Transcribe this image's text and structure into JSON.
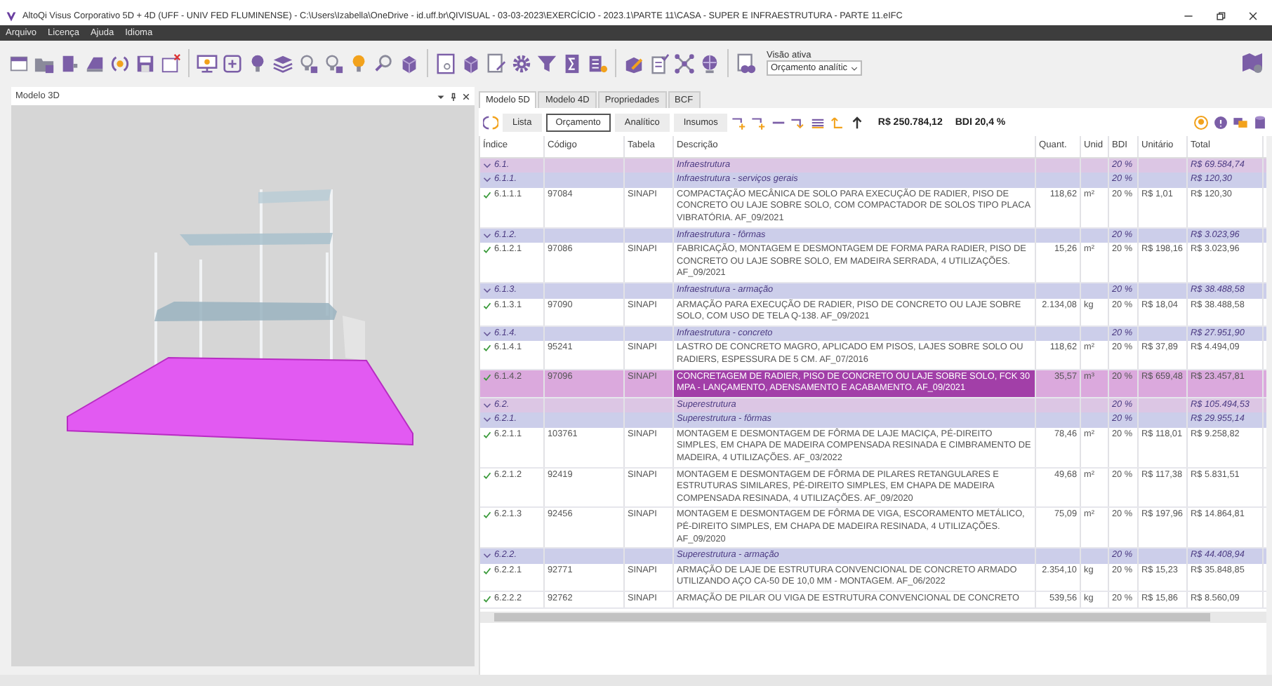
{
  "window": {
    "title": "AltoQi Visus Corporativo 5D + 4D (UFF - UNIV FED FLUMINENSE) - C:\\Users\\Izabella\\OneDrive - id.uff.br\\QIVISUAL - 03-03-2023\\EXERCÍCIO - 2023.1\\PARTE 11\\CASA - SUPER E INFRAESTRUTURA - PARTE 11.eIFC"
  },
  "menu": [
    "Arquivo",
    "Licença",
    "Ajuda",
    "Idioma"
  ],
  "toolbar": {
    "active_view_label": "Visão ativa",
    "active_view": "Orçamento analític"
  },
  "model_panel": {
    "title": "Modelo 3D"
  },
  "tabs": [
    {
      "label": "Modelo 5D",
      "selected": true
    },
    {
      "label": "Modelo 4D",
      "selected": false
    },
    {
      "label": "Propriedades",
      "selected": false
    },
    {
      "label": "BCF",
      "selected": false
    }
  ],
  "budget": {
    "views": [
      {
        "label": "Lista",
        "selected": false
      },
      {
        "label": "Orçamento",
        "selected": true
      },
      {
        "label": "Analítico",
        "selected": false
      },
      {
        "label": "Insumos",
        "selected": false
      }
    ],
    "total": "R$ 250.784,12",
    "bdi": "BDI 20,4 %"
  },
  "table": {
    "columns": [
      "Índice",
      "Código",
      "Tabela",
      "Descrição",
      "Quant.",
      "Unid",
      "BDI",
      "Unitário",
      "Total"
    ],
    "rows": [
      {
        "kind": "group",
        "index": "6.1.",
        "description": "Infraestrutura",
        "bdi": "20 %",
        "total": "R$ 69.584,74",
        "expanded": true,
        "selected": false,
        "children": [
          {
            "kind": "group",
            "index": "6.1.1.",
            "description": "Infraestrutura - serviços gerais",
            "bdi": "20 %",
            "total": "R$ 120,30",
            "expanded": true,
            "selected": false,
            "children": [
              {
                "kind": "item",
                "index": "6.1.1.1",
                "code": "97084",
                "table": "SINAPI",
                "description": "COMPACTAÇÃO MECÂNICA DE SOLO PARA EXECUÇÃO DE RADIER, PISO DE CONCRETO OU LAJE SOBRE SOLO, COM COMPACTADOR DE SOLOS TIPO PLACA VIBRATÓRIA. AF_09/2021",
                "quantity": "118,62",
                "unit": "m²",
                "bdi": "20 %",
                "unit_price": "R$ 1,01",
                "total": "R$ 120,30",
                "checked": true,
                "selected": false
              }
            ]
          },
          {
            "kind": "group",
            "index": "6.1.2.",
            "description": "Infraestrutura - fôrmas",
            "bdi": "20 %",
            "total": "R$ 3.023,96",
            "expanded": true,
            "selected": false,
            "children": [
              {
                "kind": "item",
                "index": "6.1.2.1",
                "code": "97086",
                "table": "SINAPI",
                "description": "FABRICAÇÃO, MONTAGEM E DESMONTAGEM DE FORMA PARA RADIER, PISO DE CONCRETO OU LAJE SOBRE SOLO, EM MADEIRA SERRADA, 4 UTILIZAÇÕES. AF_09/2021",
                "quantity": "15,26",
                "unit": "m²",
                "bdi": "20 %",
                "unit_price": "R$ 198,16",
                "total": "R$ 3.023,96",
                "checked": true,
                "selected": false
              }
            ]
          },
          {
            "kind": "group",
            "index": "6.1.3.",
            "description": "Infraestrutura - armação",
            "bdi": "20 %",
            "total": "R$ 38.488,58",
            "expanded": true,
            "selected": false,
            "children": [
              {
                "kind": "item",
                "index": "6.1.3.1",
                "code": "97090",
                "table": "SINAPI",
                "description": "ARMAÇÃO PARA EXECUÇÃO DE RADIER, PISO DE CONCRETO OU LAJE SOBRE SOLO, COM USO DE TELA Q-138. AF_09/2021",
                "quantity": "2.134,08",
                "unit": "kg",
                "bdi": "20 %",
                "unit_price": "R$ 18,04",
                "total": "R$ 38.488,58",
                "checked": true,
                "selected": false
              }
            ]
          },
          {
            "kind": "group",
            "index": "6.1.4.",
            "description": "Infraestrutura - concreto",
            "bdi": "20 %",
            "total": "R$ 27.951,90",
            "expanded": true,
            "selected": false,
            "children": [
              {
                "kind": "item",
                "index": "6.1.4.1",
                "code": "95241",
                "table": "SINAPI",
                "description": "LASTRO DE CONCRETO MAGRO, APLICADO EM PISOS, LAJES SOBRE SOLO OU RADIERS, ESPESSURA DE 5 CM. AF_07/2016",
                "quantity": "118,62",
                "unit": "m²",
                "bdi": "20 %",
                "unit_price": "R$ 37,89",
                "total": "R$ 4.494,09",
                "checked": true,
                "selected": false
              },
              {
                "kind": "item",
                "index": "6.1.4.2",
                "code": "97096",
                "table": "SINAPI",
                "description": "CONCRETAGEM DE RADIER, PISO DE CONCRETO OU LAJE SOBRE SOLO, FCK 30 MPA - LANÇAMENTO, ADENSAMENTO E ACABAMENTO. AF_09/2021",
                "quantity": "35,57",
                "unit": "m³",
                "bdi": "20 %",
                "unit_price": "R$ 659,48",
                "total": "R$ 23.457,81",
                "checked": true,
                "selected": true
              }
            ]
          }
        ]
      },
      {
        "kind": "group",
        "index": "6.2.",
        "description": "Superestrutura",
        "bdi": "20 %",
        "total": "R$ 105.494,53",
        "expanded": true,
        "selected": false,
        "children": [
          {
            "kind": "group",
            "index": "6.2.1.",
            "description": "Superestrutura - fôrmas",
            "bdi": "20 %",
            "total": "R$ 29.955,14",
            "expanded": true,
            "selected": false,
            "children": [
              {
                "kind": "item",
                "index": "6.2.1.1",
                "code": "103761",
                "table": "SINAPI",
                "description": "MONTAGEM E DESMONTAGEM DE FÔRMA DE LAJE MACIÇA, PÉ-DIREITO SIMPLES, EM CHAPA DE MADEIRA COMPENSADA RESINADA E CIMBRAMENTO DE MADEIRA, 4 UTILIZAÇÕES. AF_03/2022",
                "quantity": "78,46",
                "unit": "m²",
                "bdi": "20 %",
                "unit_price": "R$ 118,01",
                "total": "R$ 9.258,82",
                "checked": true,
                "selected": false
              },
              {
                "kind": "item",
                "index": "6.2.1.2",
                "code": "92419",
                "table": "SINAPI",
                "description": "MONTAGEM E DESMONTAGEM DE FÔRMA DE PILARES RETANGULARES E ESTRUTURAS SIMILARES, PÉ-DIREITO SIMPLES, EM CHAPA DE MADEIRA COMPENSADA RESINADA, 4 UTILIZAÇÕES. AF_09/2020",
                "quantity": "49,68",
                "unit": "m²",
                "bdi": "20 %",
                "unit_price": "R$ 117,38",
                "total": "R$ 5.831,51",
                "checked": true,
                "selected": false
              },
              {
                "kind": "item",
                "index": "6.2.1.3",
                "code": "92456",
                "table": "SINAPI",
                "description": "MONTAGEM E DESMONTAGEM DE FÔRMA DE VIGA, ESCORAMENTO METÁLICO, PÉ-DIREITO SIMPLES, EM CHAPA DE MADEIRA RESINADA, 4 UTILIZAÇÕES. AF_09/2020",
                "quantity": "75,09",
                "unit": "m²",
                "bdi": "20 %",
                "unit_price": "R$ 197,96",
                "total": "R$ 14.864,81",
                "checked": true,
                "selected": false
              }
            ]
          },
          {
            "kind": "group",
            "index": "6.2.2.",
            "description": "Superestrutura - armação",
            "bdi": "20 %",
            "total": "R$ 44.408,94",
            "expanded": true,
            "selected": false,
            "children": [
              {
                "kind": "item",
                "index": "6.2.2.1",
                "code": "92771",
                "table": "SINAPI",
                "description": "ARMAÇÃO DE LAJE DE ESTRUTURA CONVENCIONAL DE CONCRETO ARMADO UTILIZANDO AÇO CA-50 DE 10,0 MM - MONTAGEM. AF_06/2022",
                "quantity": "2.354,10",
                "unit": "kg",
                "bdi": "20 %",
                "unit_price": "R$ 15,23",
                "total": "R$ 35.848,85",
                "checked": true,
                "selected": false
              },
              {
                "kind": "item",
                "index": "6.2.2.2",
                "code": "92762",
                "table": "SINAPI",
                "description": "ARMAÇÃO DE PILAR OU VIGA DE ESTRUTURA CONVENCIONAL DE CONCRETO",
                "quantity": "539,56",
                "unit": "kg",
                "bdi": "20 %",
                "unit_price": "R$ 15,86",
                "total": "R$ 8.560,09",
                "checked": true,
                "selected": false
              }
            ]
          }
        ]
      }
    ]
  }
}
